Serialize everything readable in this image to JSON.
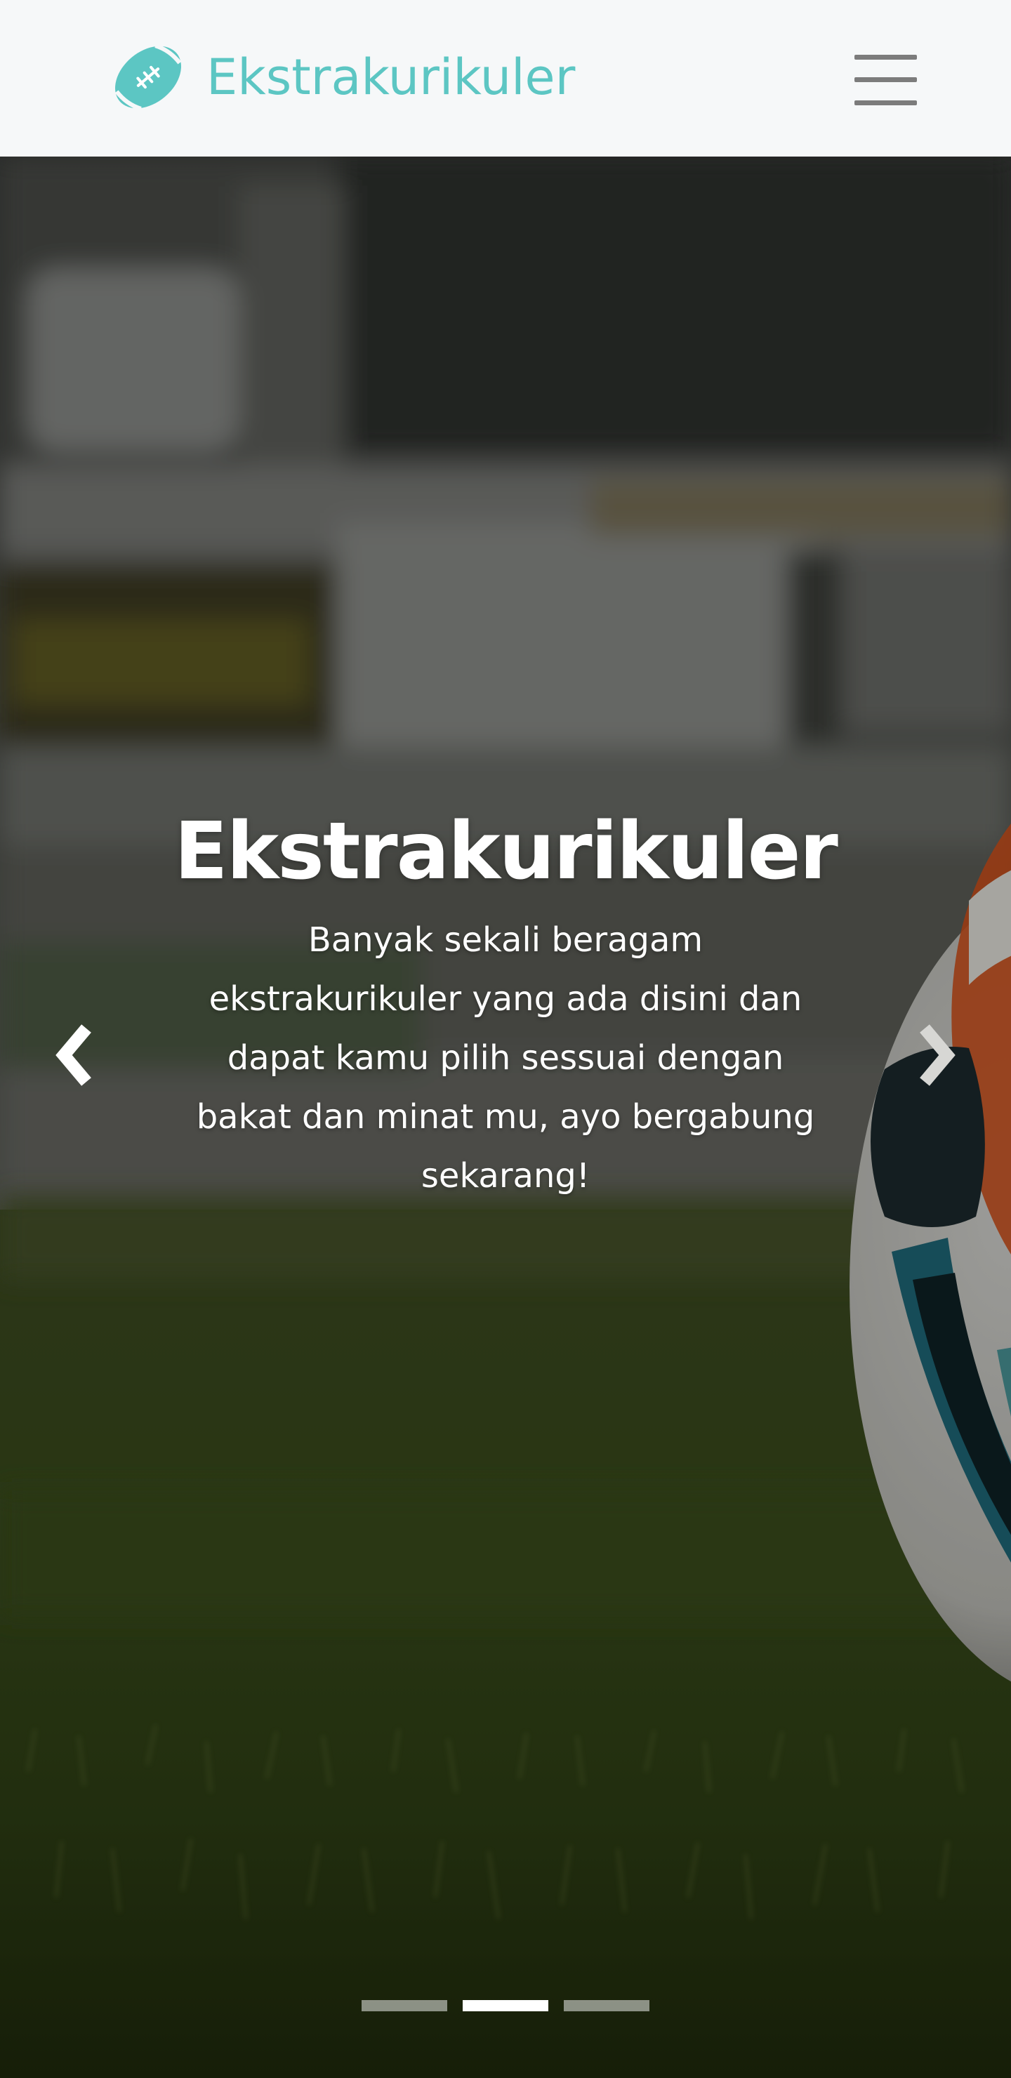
{
  "navbar": {
    "brand_name": "Ekstrakurikuler",
    "brand_icon": "football-icon",
    "menu_icon": "hamburger-menu-icon",
    "brand_color": "#5cc6c3"
  },
  "carousel": {
    "background": "soccer-ball-on-grass-photo",
    "slides_count": 3,
    "active_slide": 2,
    "caption": {
      "title": "Ekstrakurikuler",
      "text": "Banyak sekali beragam ekstrakurikuler yang ada disini dan dapat kamu pilih sessuai dengan bakat dan minat mu, ayo bergabung sekarang!"
    },
    "prev_icon": "chevron-left-icon",
    "next_icon": "chevron-right-icon"
  }
}
